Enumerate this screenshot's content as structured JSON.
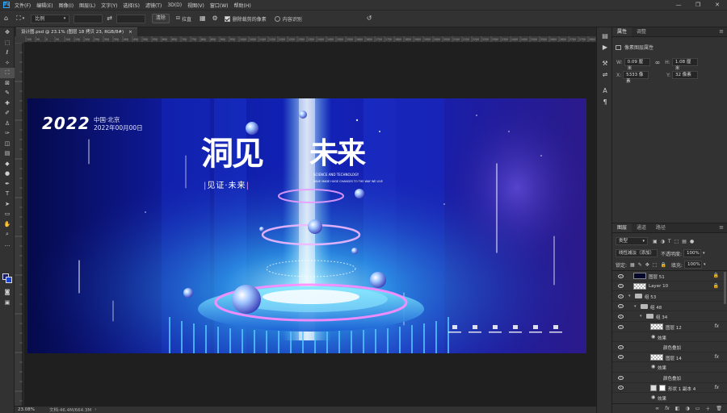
{
  "menubar": {
    "logo": "Ps",
    "items": [
      "文件(F)",
      "编辑(E)",
      "图像(I)",
      "图层(L)",
      "文字(Y)",
      "选择(S)",
      "滤镜(T)",
      "3D(D)",
      "视图(V)",
      "窗口(W)",
      "帮助(H)"
    ],
    "window_controls": [
      "—",
      "❐",
      "✕"
    ]
  },
  "options": {
    "ratio": "比例",
    "clear_label": "清除",
    "straighten_label": "拉直",
    "delete_cropped_label": "删除裁剪的像素",
    "content_aware_label": "内容识别"
  },
  "document": {
    "tab_title": "设计图.psd @ 23.1% (图层 18 拷贝 23, RGB/8#)",
    "tab_close": "×"
  },
  "ruler": {
    "h_ticks": [
      "100",
      "50",
      "0",
      "50",
      "100",
      "150",
      "200",
      "250",
      "300",
      "350",
      "400",
      "450",
      "500",
      "550",
      "600",
      "650",
      "700",
      "750",
      "800",
      "850",
      "900",
      "950",
      "1000",
      "1050",
      "1100",
      "1150",
      "1200",
      "1250",
      "1300",
      "1350",
      "1400",
      "1450",
      "1500",
      "1550",
      "1600",
      "1650",
      "1700",
      "1750",
      "1800",
      "1850",
      "1900",
      "1950",
      "2000",
      "2050",
      "2100",
      "2150",
      "2200",
      "2250",
      "2300",
      "2350",
      "2400",
      "2450",
      "2500",
      "2550",
      "2600",
      "2650",
      "2700",
      "2750",
      "2800",
      "2850",
      "2900",
      "2950"
    ]
  },
  "artwork": {
    "year": "2022",
    "location": "中国·北京",
    "date": "2022年00月00日",
    "title_left": "洞见",
    "title_right": "未来",
    "subtitle": "见证·未来",
    "tagline_1": "SCIENCE AND TECHNOLOGY",
    "tagline_2": "HAVE MADE HUGE CHANGES TO THE WAY WE LIVE"
  },
  "status": {
    "zoom": "23.08%",
    "doc_size": "文档:46.4M/664.3M"
  },
  "properties": {
    "tabs": [
      "属性",
      "调整"
    ],
    "title": "像素图层属性",
    "w_label": "W:",
    "w_value": "0.09 厘米",
    "link_icon": "∞",
    "h_label": "H:",
    "h_value": "1.08 厘米",
    "x_label": "X:",
    "x_value": "5333 像素",
    "y_label": "Y:",
    "y_value": "32 像素"
  },
  "layers_panel": {
    "tabs": [
      "图层",
      "通道",
      "路径"
    ],
    "filter_kind": "类型",
    "blend_mode": "线性减淡（添加）",
    "opacity_label": "不透明度:",
    "opacity_value": "100%",
    "lock_label": "锁定:",
    "fill_label": "填充:",
    "fill_value": "100%",
    "rows": [
      {
        "name": "图层 51",
        "indent": 0,
        "type": "thumb-dark",
        "lock": true
      },
      {
        "name": "Layer 10",
        "indent": 0,
        "type": "thumb-check",
        "lock": true
      },
      {
        "name": "组 53",
        "indent": 0,
        "type": "group"
      },
      {
        "name": "组 48",
        "indent": 1,
        "type": "group"
      },
      {
        "name": "组 34",
        "indent": 2,
        "type": "group"
      },
      {
        "name": "图层 12",
        "indent": 3,
        "type": "thumb-check",
        "fx": true
      },
      {
        "name": "效果",
        "indent": 4,
        "type": "effect"
      },
      {
        "name": "颜色叠加",
        "indent": 5,
        "type": "effect-item"
      },
      {
        "name": "图层 14",
        "indent": 3,
        "type": "thumb-check",
        "fx": true
      },
      {
        "name": "效果",
        "indent": 4,
        "type": "effect"
      },
      {
        "name": "颜色叠加",
        "indent": 5,
        "type": "effect-item"
      },
      {
        "name": "形状 1 副本 4",
        "indent": 3,
        "type": "thumb-shape",
        "fx": true
      },
      {
        "name": "效果",
        "indent": 4,
        "type": "effect"
      },
      {
        "name": "颜色叠加",
        "indent": 5,
        "type": "effect-item"
      },
      {
        "name": "形状 1 副本 3",
        "indent": 3,
        "type": "thumb-shape",
        "fx": true
      }
    ],
    "bottom_icons": [
      "∞",
      "fx",
      "◧",
      "◑",
      "▭",
      "＋",
      "🗑"
    ]
  },
  "colors": {
    "accent": "#31a8ff",
    "panel": "#323232",
    "canvas_bg": "#1f1f1f"
  }
}
